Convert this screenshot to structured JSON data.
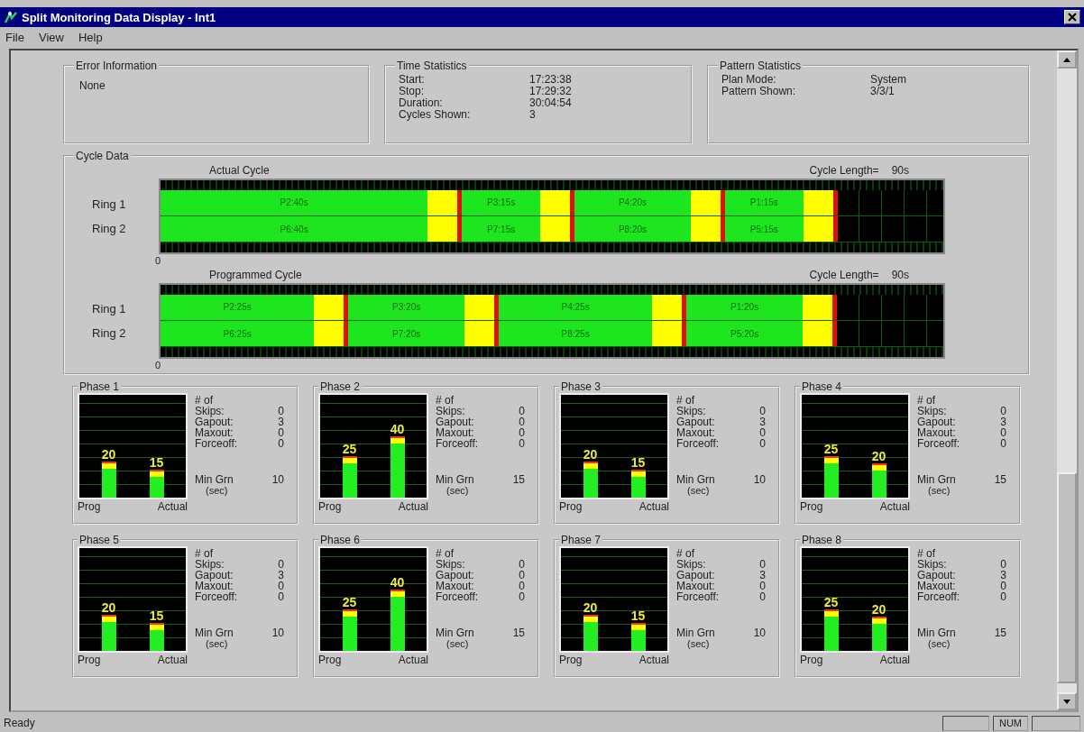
{
  "window": {
    "title": "Split Monitoring Data Display - Int1"
  },
  "menu": [
    "File",
    "View",
    "Help"
  ],
  "error_information": {
    "title": "Error Information",
    "text": "None"
  },
  "time_statistics": {
    "title": "Time Statistics",
    "rows": [
      {
        "label": "Start:",
        "value": "17:23:38"
      },
      {
        "label": "Stop:",
        "value": "17:29:32"
      },
      {
        "label": "Duration:",
        "value": "30:04:54"
      },
      {
        "label": "Cycles Shown:",
        "value": "3"
      }
    ]
  },
  "pattern_statistics": {
    "title": "Pattern Statistics",
    "rows": [
      {
        "label": "Plan Mode:",
        "value": "System"
      },
      {
        "label": "Pattern Shown:",
        "value": "3/3/1"
      }
    ]
  },
  "cycle_data": {
    "title": "Cycle Data",
    "cycles": [
      {
        "title": "Actual Cycle",
        "length_label": "Cycle Length=",
        "length": "90s",
        "axis_start": "0",
        "rings": [
          {
            "label": "Ring 1",
            "segments": [
              {
                "label": "P2:40s"
              },
              {
                "label": "P3:15s"
              },
              {
                "label": "P4:20s"
              },
              {
                "label": "P1:15s"
              }
            ]
          },
          {
            "label": "Ring 2",
            "segments": [
              {
                "label": "P6:40s"
              },
              {
                "label": "P7:15s"
              },
              {
                "label": "P8:20s"
              },
              {
                "label": "P5:15s"
              }
            ]
          }
        ]
      },
      {
        "title": "Programmed Cycle",
        "length_label": "Cycle Length=",
        "length": "90s",
        "axis_start": "0",
        "rings": [
          {
            "label": "Ring 1",
            "segments": [
              {
                "label": "P2:25s"
              },
              {
                "label": "P3:20s"
              },
              {
                "label": "P4:25s"
              },
              {
                "label": "P1:20s"
              }
            ]
          },
          {
            "label": "Ring 2",
            "segments": [
              {
                "label": "P6:25s"
              },
              {
                "label": "P7:20s"
              },
              {
                "label": "P8:25s"
              },
              {
                "label": "P5:20s"
              }
            ]
          }
        ]
      }
    ]
  },
  "phases": [
    {
      "title": "Phase 1",
      "bars": [
        {
          "label": "Prog",
          "value": "20"
        },
        {
          "label": "Actual",
          "value": "15"
        }
      ],
      "heading": "# of",
      "stats": [
        {
          "label": "Skips:",
          "value": "0"
        },
        {
          "label": "Gapout:",
          "value": "3"
        },
        {
          "label": "Maxout:",
          "value": "0"
        },
        {
          "label": "Forceoff:",
          "value": "0"
        }
      ],
      "min_label": "Min Grn",
      "min_value": "10",
      "unit": "(sec)"
    },
    {
      "title": "Phase 2",
      "bars": [
        {
          "label": "Prog",
          "value": "25"
        },
        {
          "label": "Actual",
          "value": "40"
        }
      ],
      "heading": "# of",
      "stats": [
        {
          "label": "Skips:",
          "value": "0"
        },
        {
          "label": "Gapout:",
          "value": "0"
        },
        {
          "label": "Maxout:",
          "value": "0"
        },
        {
          "label": "Forceoff:",
          "value": "0"
        }
      ],
      "min_label": "Min Grn",
      "min_value": "15",
      "unit": "(sec)"
    },
    {
      "title": "Phase 3",
      "bars": [
        {
          "label": "Prog",
          "value": "20"
        },
        {
          "label": "Actual",
          "value": "15"
        }
      ],
      "heading": "# of",
      "stats": [
        {
          "label": "Skips:",
          "value": "0"
        },
        {
          "label": "Gapout:",
          "value": "3"
        },
        {
          "label": "Maxout:",
          "value": "0"
        },
        {
          "label": "Forceoff:",
          "value": "0"
        }
      ],
      "min_label": "Min Grn",
      "min_value": "10",
      "unit": "(sec)"
    },
    {
      "title": "Phase 4",
      "bars": [
        {
          "label": "Prog",
          "value": "25"
        },
        {
          "label": "Actual",
          "value": "20"
        }
      ],
      "heading": "# of",
      "stats": [
        {
          "label": "Skips:",
          "value": "0"
        },
        {
          "label": "Gapout:",
          "value": "3"
        },
        {
          "label": "Maxout:",
          "value": "0"
        },
        {
          "label": "Forceoff:",
          "value": "0"
        }
      ],
      "min_label": "Min Grn",
      "min_value": "15",
      "unit": "(sec)"
    },
    {
      "title": "Phase 5",
      "bars": [
        {
          "label": "Prog",
          "value": "20"
        },
        {
          "label": "Actual",
          "value": "15"
        }
      ],
      "heading": "# of",
      "stats": [
        {
          "label": "Skips:",
          "value": "0"
        },
        {
          "label": "Gapout:",
          "value": "3"
        },
        {
          "label": "Maxout:",
          "value": "0"
        },
        {
          "label": "Forceoff:",
          "value": "0"
        }
      ],
      "min_label": "Min Grn",
      "min_value": "10",
      "unit": "(sec)"
    },
    {
      "title": "Phase 6",
      "bars": [
        {
          "label": "Prog",
          "value": "25"
        },
        {
          "label": "Actual",
          "value": "40"
        }
      ],
      "heading": "# of",
      "stats": [
        {
          "label": "Skips:",
          "value": "0"
        },
        {
          "label": "Gapout:",
          "value": "0"
        },
        {
          "label": "Maxout:",
          "value": "0"
        },
        {
          "label": "Forceoff:",
          "value": "0"
        }
      ],
      "min_label": "Min Grn",
      "min_value": "15",
      "unit": "(sec)"
    },
    {
      "title": "Phase 7",
      "bars": [
        {
          "label": "Prog",
          "value": "20"
        },
        {
          "label": "Actual",
          "value": "15"
        }
      ],
      "heading": "# of",
      "stats": [
        {
          "label": "Skips:",
          "value": "0"
        },
        {
          "label": "Gapout:",
          "value": "3"
        },
        {
          "label": "Maxout:",
          "value": "0"
        },
        {
          "label": "Forceoff:",
          "value": "0"
        }
      ],
      "min_label": "Min Grn",
      "min_value": "10",
      "unit": "(sec)"
    },
    {
      "title": "Phase 8",
      "bars": [
        {
          "label": "Prog",
          "value": "25"
        },
        {
          "label": "Actual",
          "value": "20"
        }
      ],
      "heading": "# of",
      "stats": [
        {
          "label": "Skips:",
          "value": "0"
        },
        {
          "label": "Gapout:",
          "value": "3"
        },
        {
          "label": "Maxout:",
          "value": "0"
        },
        {
          "label": "Forceoff:",
          "value": "0"
        }
      ],
      "min_label": "Min Grn",
      "min_value": "15",
      "unit": "(sec)"
    }
  ],
  "status_bar": {
    "text": "Ready",
    "indicator": "NUM"
  }
}
